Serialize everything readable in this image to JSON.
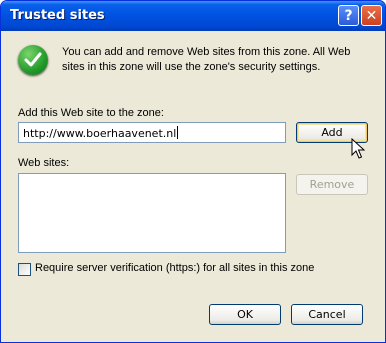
{
  "window": {
    "title": "Trusted sites"
  },
  "titlebar_buttons": {
    "help": "?",
    "close": "✕"
  },
  "info": {
    "text": "You can add and remove Web sites from this zone. All Web sites in this zone will use the zone's security settings."
  },
  "add": {
    "label": "Add this Web site to the zone:",
    "value": "http://www.boerhaavenet.nl",
    "button": "Add"
  },
  "sites": {
    "label": "Web sites:",
    "items": [],
    "remove_button": "Remove"
  },
  "verification": {
    "label": "Require server verification (https:) for all sites in this zone",
    "checked": false
  },
  "footer": {
    "ok": "OK",
    "cancel": "Cancel"
  },
  "colors": {
    "titlebar": "#0055e5",
    "dialog_bg": "#ece9d8",
    "input_border": "#7f9db9"
  },
  "icons": {
    "info": "checkmark-icon",
    "pointer": "mouse-pointer-icon"
  }
}
